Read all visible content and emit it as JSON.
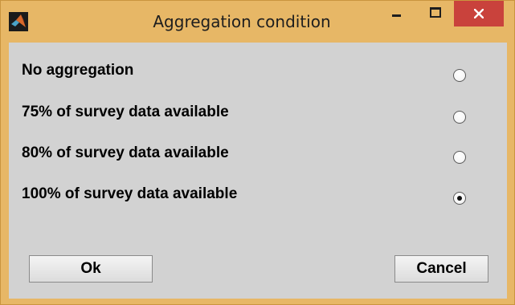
{
  "window": {
    "title": "Aggregation condition",
    "icon": "matlab-icon",
    "controls": [
      "minimize-icon",
      "maximize-icon",
      "close-icon"
    ]
  },
  "options": [
    {
      "label": "No aggregation",
      "selected": false
    },
    {
      "label": "75% of survey data available",
      "selected": false
    },
    {
      "label": "80% of survey data available",
      "selected": false
    },
    {
      "label": "100% of survey data available",
      "selected": true
    }
  ],
  "buttons": {
    "ok_label": "Ok",
    "cancel_label": "Cancel"
  },
  "colors": {
    "frame": "#e7b766",
    "client_bg": "#d2d2d2",
    "close_button": "#c9423c"
  }
}
